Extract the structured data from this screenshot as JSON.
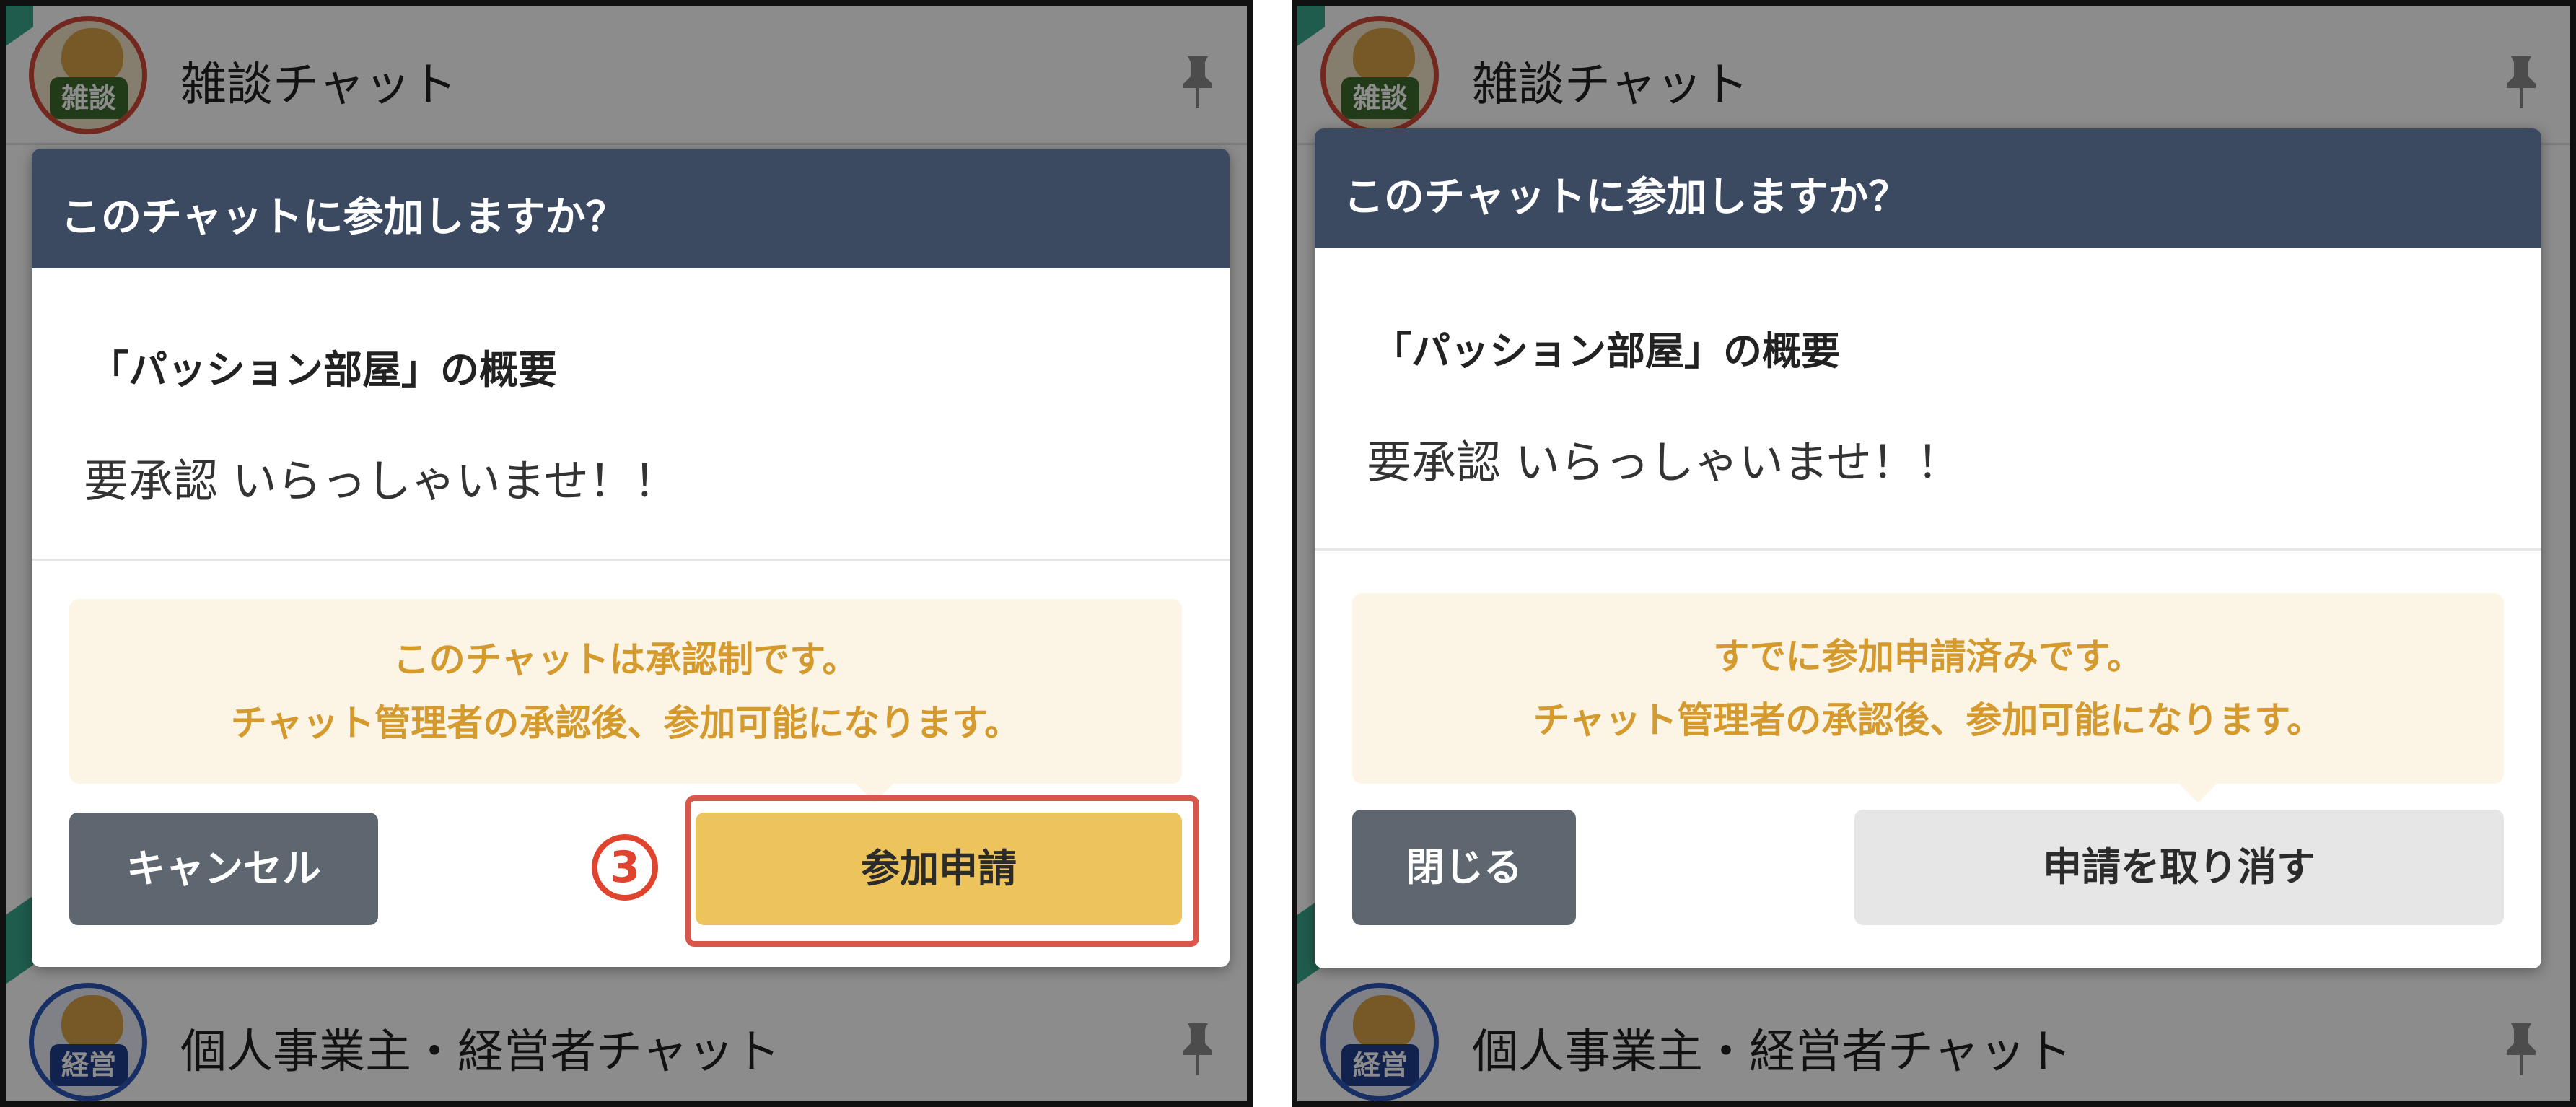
{
  "chat_list": {
    "top_chat_name": "雑談チャット",
    "top_chat_badge": "雑談",
    "bottom_chat_name": "個人事業主・経営者チャット",
    "bottom_chat_badge": "経営"
  },
  "left_dialog": {
    "title": "このチャットに参加しますか？",
    "room_heading": "「パッション部屋」の概要",
    "room_description": "要承認 いらっしゃいませ！！",
    "notice_line1": "このチャットは承認制です。",
    "notice_line2": "チャット管理者の承認後、参加可能になります。",
    "cancel_label": "キャンセル",
    "join_request_label": "参加申請",
    "step_marker": "3"
  },
  "right_dialog": {
    "title": "このチャットに参加しますか？",
    "room_heading": "「パッション部屋」の概要",
    "room_description": "要承認 いらっしゃいませ！！",
    "notice_line1": "すでに参加申請済みです。",
    "notice_line2": "チャット管理者の承認後、参加可能になります。",
    "close_label": "閉じる",
    "cancel_request_label": "申請を取り消す"
  },
  "colors": {
    "header_bg": "#3c4a61",
    "notice_bg": "#fcf4e4",
    "notice_text": "#d49a2e",
    "primary_button": "#edc45c",
    "secondary_button": "#5e6670",
    "highlight": "#d9574a"
  }
}
